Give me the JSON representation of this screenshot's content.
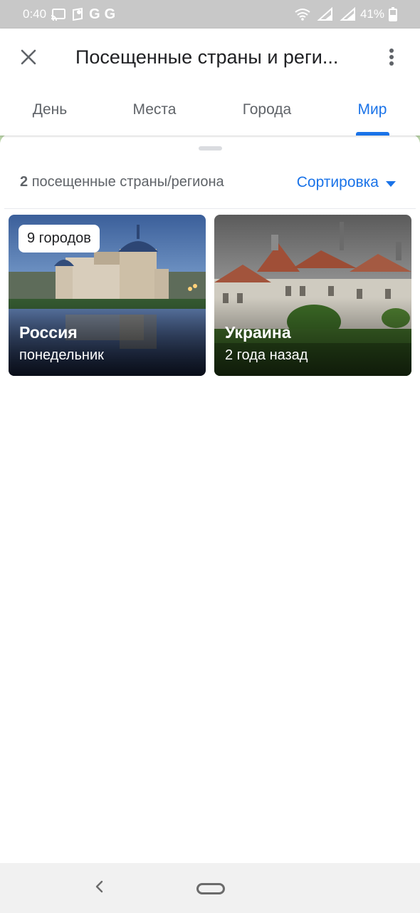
{
  "status_bar": {
    "time": "0:40",
    "battery": "41%",
    "icons": [
      "cast-icon",
      "location-icon",
      "google-g-icon",
      "google-g-icon",
      "wifi-icon",
      "signal-icon",
      "signal-icon",
      "battery-icon"
    ],
    "g1": "G",
    "g2": "G"
  },
  "app_bar": {
    "title": "Посещенные страны и реги...",
    "close_icon": "close-icon",
    "more_icon": "more-vert-icon"
  },
  "tabs": [
    {
      "label": "День",
      "active": false
    },
    {
      "label": "Места",
      "active": false
    },
    {
      "label": "Города",
      "active": false
    },
    {
      "label": "Мир",
      "active": true
    }
  ],
  "summary": {
    "count": "2",
    "text": "посещенные страны/региона",
    "sort_label": "Сортировка"
  },
  "cards": [
    {
      "country": "Россия",
      "date": "понедельник",
      "chip": "9 городов"
    },
    {
      "country": "Украина",
      "date": "2 года назад"
    }
  ],
  "colors": {
    "accent": "#1a73e8",
    "status_bar": "#c8c8c8",
    "text_secondary": "#5f6368"
  }
}
